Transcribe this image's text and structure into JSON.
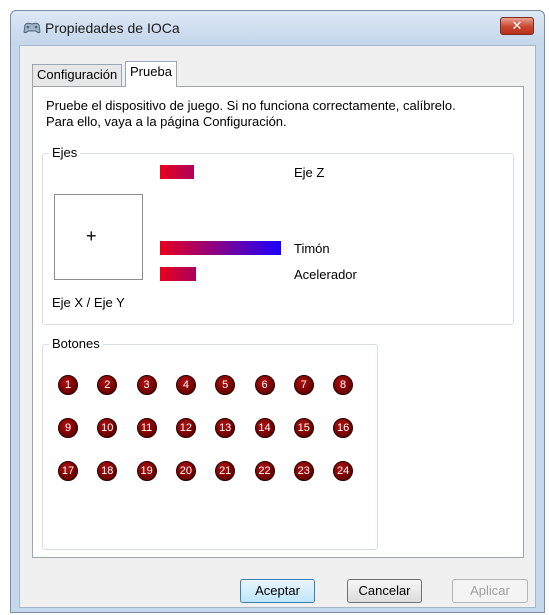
{
  "window": {
    "title": "Propiedades de IOCa",
    "close_label": "✕"
  },
  "tabs": [
    {
      "label": "Configuración",
      "active": false
    },
    {
      "label": "Prueba",
      "active": true
    }
  ],
  "description": {
    "line1": "Pruebe el dispositivo de juego. Si no funciona correctamente, calíbrelo.",
    "line2": "Para ello, vaya a la página Configuración."
  },
  "axes_group": {
    "legend": "Ejes",
    "xy_label": "Eje X / Eje Y",
    "crosshair": "+",
    "axes": [
      {
        "label": "Eje Z",
        "fill_fraction": 0.28
      },
      {
        "label": "Timón",
        "fill_fraction": 1.0
      },
      {
        "label": "Acelerador",
        "fill_fraction": 0.3
      }
    ],
    "bar_gradient": [
      "#e8001c",
      "#1a00ff"
    ]
  },
  "buttons_group": {
    "legend": "Botones",
    "buttons": [
      "1",
      "2",
      "3",
      "4",
      "5",
      "6",
      "7",
      "8",
      "9",
      "10",
      "11",
      "12",
      "13",
      "14",
      "15",
      "16",
      "17",
      "18",
      "19",
      "20",
      "21",
      "22",
      "23",
      "24"
    ]
  },
  "dialog_buttons": {
    "ok": "Aceptar",
    "cancel": "Cancelar",
    "apply": "Aplicar"
  }
}
